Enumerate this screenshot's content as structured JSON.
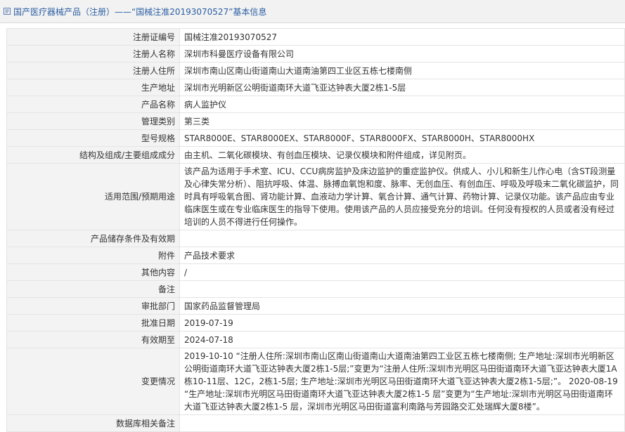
{
  "header": {
    "title": "国产医疗器械产品（注册）——“国械注准20193070527”基本信息"
  },
  "rows": [
    {
      "label": "注册证编号",
      "value": "国械注准20193070527"
    },
    {
      "label": "注册人名称",
      "value": "深圳市科曼医疗设备有限公司"
    },
    {
      "label": "注册人住所",
      "value": "深圳市南山区南山街道南山大道南油第四工业区五栋七楼南侧"
    },
    {
      "label": "生产地址",
      "value": "深圳市光明新区公明街道南环大道飞亚达钟表大厦2栋1-5层"
    },
    {
      "label": "产品名称",
      "value": "病人监护仪"
    },
    {
      "label": "管理类别",
      "value": "第三类"
    },
    {
      "label": "型号规格",
      "value": "STAR8000E、STAR8000EX、STAR8000F、STAR8000FX、STAR8000H、STAR8000HX"
    },
    {
      "label": "结构及组成/主要组成成分",
      "value": "由主机、二氧化碳模块、有创血压模块、记录仪模块和附件组成，详见附页。"
    },
    {
      "label": "适用范围/预期用途",
      "value": "该产品为适用于手术室、ICU、CCU病房监护及床边监护的重症监护仪。供成人、小儿和新生儿作心电（含ST段测量及心律失常分析）、阻抗呼吸、体温、脉搏血氧饱和度、脉率、无创血压、有创血压、呼吸及呼吸末二氧化碳监护，同时具有呼吸氧合图、肾功能计算、血液动力学计算、氧合计算、通气计算、药物计算、记录仪功能。该产品应由专业临床医生或在专业临床医生的指导下使用。使用该产品的人员应接受充分的培训。任何没有授权的人员或者没有经过培训的人员不得进行任何操作。"
    },
    {
      "label": "产品储存条件及有效期",
      "value": ""
    },
    {
      "label": "附件",
      "value": "产品技术要求"
    },
    {
      "label": "其他内容",
      "value": "/"
    },
    {
      "label": "备注",
      "value": ""
    },
    {
      "label": "审批部门",
      "value": "国家药品监督管理局"
    },
    {
      "label": "批准日期",
      "value": "2019-07-19"
    },
    {
      "label": "有效期至",
      "value": "2024-07-18"
    },
    {
      "label": "变更情况",
      "value": "2019-10-10 “注册人住所:深圳市南山区南山街道南山大道南油第四工业区五栋七楼南侧; 生产地址:深圳市光明新区公明街道南环大道飞亚达钟表大厦2栋1-5层;”变更为“注册人住所:深圳市光明区马田街道南环大道飞亚达钟表大厦1A栋10-11层、12C，2栋1-5层; 生产地址:深圳市光明区马田街道南环大道飞亚达钟表大厦2栋1-5层;”。 2020-08-19 “生产地址:深圳市光明区马田街道南环大道飞亚达钟表大厦2栋1-5 层”变更为“生产地址:深圳市光明区马田街道南环大道飞亚达钟表大厦2栋1-5 层，深圳市光明区马田街道富利南路与芳园路交汇处瑞辉大厦8楼”。"
    },
    {
      "label": "数据库相关备注",
      "value": ""
    }
  ]
}
